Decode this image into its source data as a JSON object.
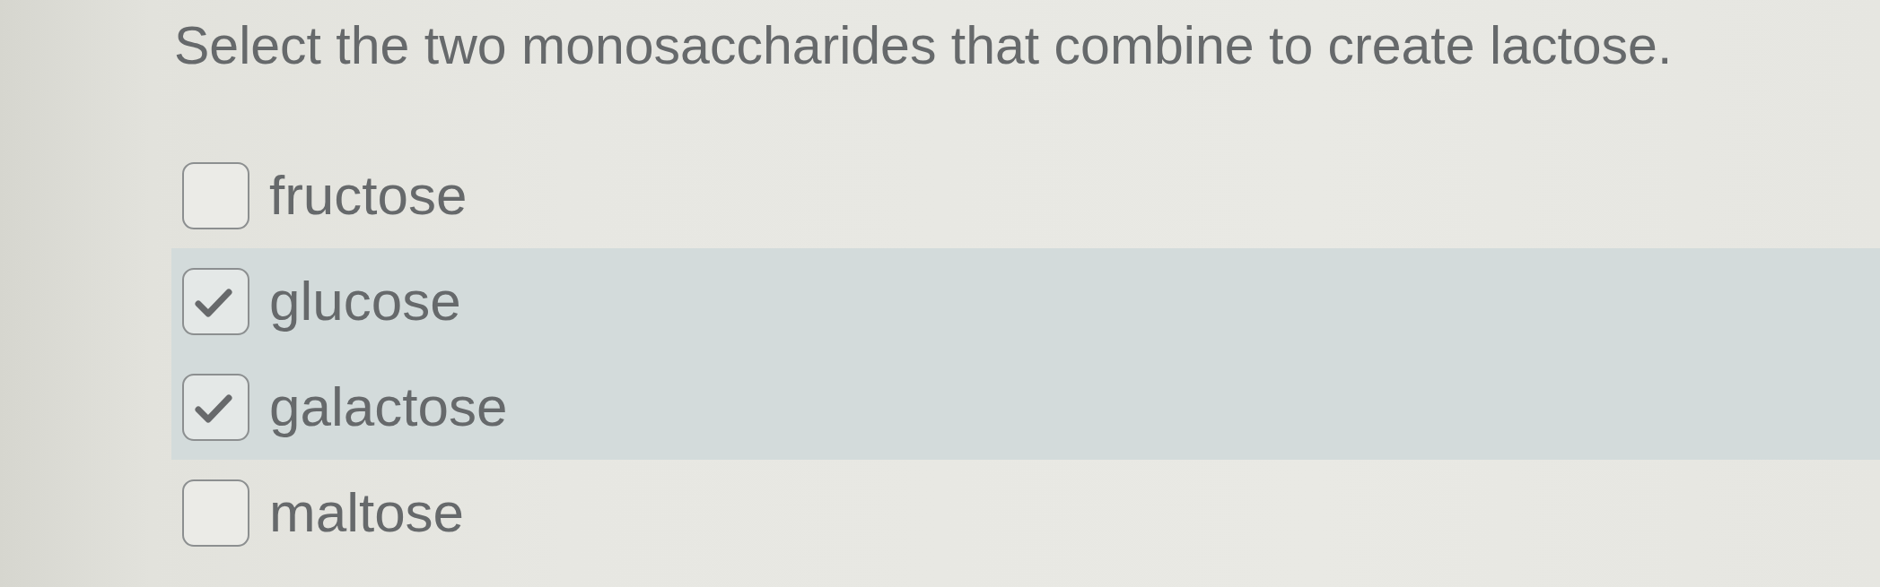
{
  "question": {
    "text": "Select the two monosaccharides that combine to create lactose."
  },
  "options": [
    {
      "label": "fructose",
      "checked": false
    },
    {
      "label": "glucose",
      "checked": true
    },
    {
      "label": "galactose",
      "checked": true
    },
    {
      "label": "maltose",
      "checked": false
    }
  ]
}
